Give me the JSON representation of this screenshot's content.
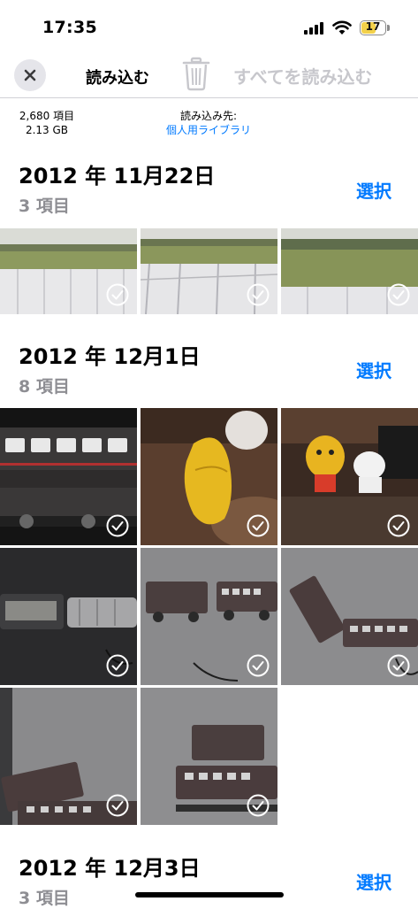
{
  "status": {
    "time": "17:35",
    "battery_level": "17"
  },
  "toolbar": {
    "title": "読み込む",
    "import_all_label": "すべてを読み込む"
  },
  "info": {
    "count_line1": "2,680 項目",
    "count_line2": "2.13 GB",
    "destination_label": "読み込み先:",
    "destination_value": "個人用ライブラリ"
  },
  "sections": [
    {
      "date": "2012 年 11月22日",
      "count": "3 項目",
      "select_label": "選択"
    },
    {
      "date": "2012 年 12月1日",
      "count": "8 項目",
      "select_label": "選択"
    },
    {
      "date": "2012 年 12月3日",
      "count": "3 項目",
      "select_label": "選択"
    }
  ],
  "icons": {
    "close": "close-icon",
    "trash": "trash-icon",
    "check": "checkmark-circle-icon"
  },
  "colors": {
    "accent": "#007aff",
    "disabled": "#c7c7cc",
    "secondary": "#8e8e93"
  }
}
